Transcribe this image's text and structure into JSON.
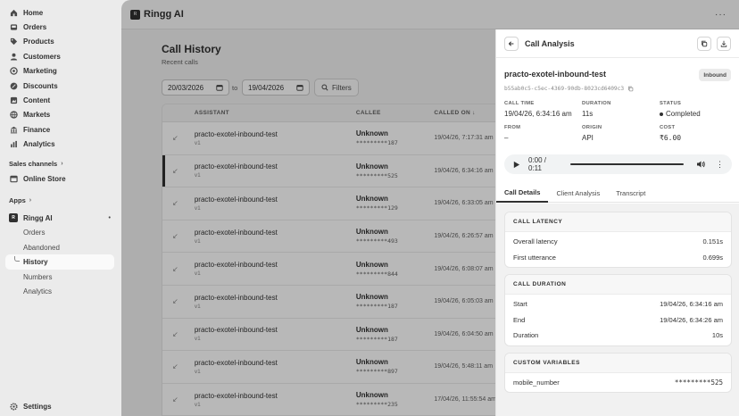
{
  "sidebar": {
    "items": [
      {
        "label": "Home",
        "icon": "home-icon"
      },
      {
        "label": "Orders",
        "icon": "inbox-icon"
      },
      {
        "label": "Products",
        "icon": "tag-icon"
      },
      {
        "label": "Customers",
        "icon": "person-icon"
      },
      {
        "label": "Marketing",
        "icon": "target-icon"
      },
      {
        "label": "Discounts",
        "icon": "discount-icon"
      },
      {
        "label": "Content",
        "icon": "content-icon"
      },
      {
        "label": "Markets",
        "icon": "globe-icon"
      },
      {
        "label": "Finance",
        "icon": "bank-icon"
      },
      {
        "label": "Analytics",
        "icon": "chart-icon"
      }
    ],
    "sales_channels_label": "Sales channels",
    "online_store_label": "Online Store",
    "apps_label": "Apps",
    "app_name": "Ringg AI",
    "app_subitems": [
      "Orders",
      "Abandoned",
      "History",
      "Numbers",
      "Analytics"
    ],
    "active_subitem": "History",
    "settings_label": "Settings"
  },
  "topbar": {
    "title": "Ringg AI"
  },
  "main": {
    "title": "Call History",
    "subtitle": "Recent calls",
    "date_from": "20/03/2026",
    "to_label": "to",
    "date_to": "19/04/2026",
    "filters_label": "Filters",
    "columns": [
      "ASSISTANT",
      "CALLEE",
      "CALLED ON ↓"
    ],
    "rows": [
      {
        "assistant": "practo-exotel-inbound-test",
        "version": "v1",
        "callee": "Unknown",
        "number": "*********187",
        "called_on": "19/04/26, 7:17:31 am"
      },
      {
        "assistant": "practo-exotel-inbound-test",
        "version": "v1",
        "callee": "Unknown",
        "number": "*********525",
        "called_on": "19/04/26, 6:34:16 am"
      },
      {
        "assistant": "practo-exotel-inbound-test",
        "version": "v1",
        "callee": "Unknown",
        "number": "*********129",
        "called_on": "19/04/26, 6:33:05 am"
      },
      {
        "assistant": "practo-exotel-inbound-test",
        "version": "v1",
        "callee": "Unknown",
        "number": "*********493",
        "called_on": "19/04/26, 6:26:57 am"
      },
      {
        "assistant": "practo-exotel-inbound-test",
        "version": "v1",
        "callee": "Unknown",
        "number": "*********844",
        "called_on": "19/04/26, 6:08:07 am"
      },
      {
        "assistant": "practo-exotel-inbound-test",
        "version": "v1",
        "callee": "Unknown",
        "number": "*********187",
        "called_on": "19/04/26, 6:05:03 am"
      },
      {
        "assistant": "practo-exotel-inbound-test",
        "version": "v1",
        "callee": "Unknown",
        "number": "*********187",
        "called_on": "19/04/26, 6:04:50 am"
      },
      {
        "assistant": "practo-exotel-inbound-test",
        "version": "v1",
        "callee": "Unknown",
        "number": "*********897",
        "called_on": "19/04/26, 5:48:11 am"
      },
      {
        "assistant": "practo-exotel-inbound-test",
        "version": "v1",
        "callee": "Unknown",
        "number": "*********235",
        "called_on": "17/04/26, 11:55:54 am"
      }
    ]
  },
  "panel": {
    "title": "Call Analysis",
    "assistant": "practo-exotel-inbound-test",
    "badge": "Inbound",
    "call_id": "b55ab0c5-c5ec-4369-90db-8023cd6409c3",
    "fields": [
      {
        "label": "CALL TIME",
        "value": "19/04/26, 6:34:16 am"
      },
      {
        "label": "DURATION",
        "value": "11s"
      },
      {
        "label": "STATUS",
        "value": "Completed"
      },
      {
        "label": "FROM",
        "value": "–"
      },
      {
        "label": "ORIGIN",
        "value": "API"
      },
      {
        "label": "COST",
        "value": "₹6.00"
      }
    ],
    "audio_time": "0:00 / 0:11",
    "tabs": [
      "Call Details",
      "Client Analysis",
      "Transcript"
    ],
    "active_tab": "Call Details",
    "latency": {
      "heading": "CALL LATENCY",
      "rows": [
        {
          "k": "Overall latency",
          "v": "0.151s"
        },
        {
          "k": "First utterance",
          "v": "0.699s"
        }
      ]
    },
    "duration": {
      "heading": "CALL DURATION",
      "rows": [
        {
          "k": "Start",
          "v": "19/04/26, 6:34:16 am"
        },
        {
          "k": "End",
          "v": "19/04/26, 6:34:26 am"
        },
        {
          "k": "Duration",
          "v": "10s"
        }
      ]
    },
    "custom_vars": {
      "heading": "CUSTOM VARIABLES",
      "rows": [
        {
          "k": "mobile_number",
          "v": "*********525"
        }
      ]
    }
  },
  "colors": {
    "accent": "#303030",
    "background": "#ebebeb",
    "overlay": "rgba(0,0,0,0.28)"
  }
}
